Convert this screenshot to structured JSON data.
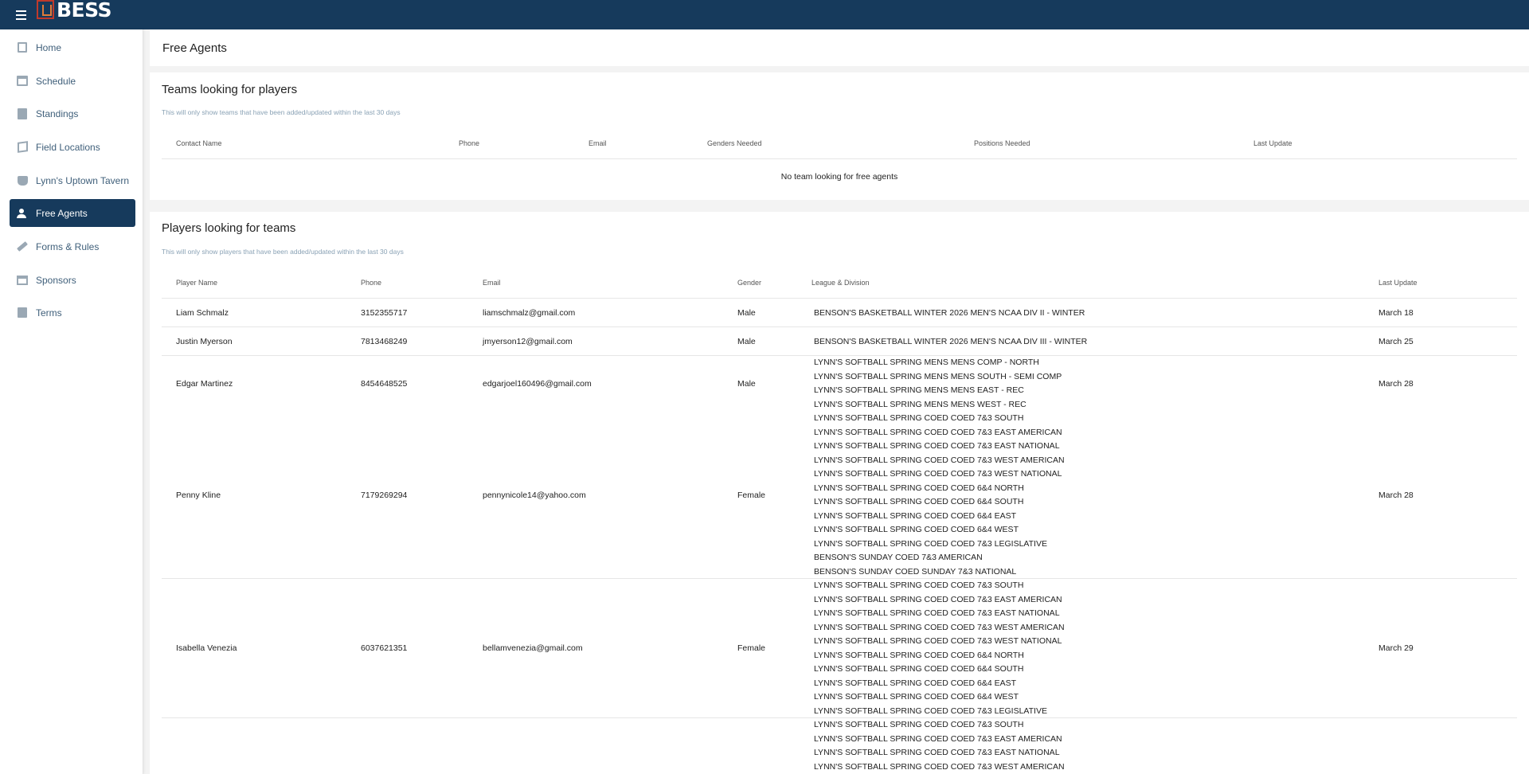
{
  "app": {
    "logo_text": "BESS"
  },
  "sidebar": {
    "items": [
      {
        "label": "Home",
        "icon": "copy-icon"
      },
      {
        "label": "Schedule",
        "icon": "calendar-icon"
      },
      {
        "label": "Standings",
        "icon": "clipboard-icon"
      },
      {
        "label": "Field Locations",
        "icon": "map-icon"
      },
      {
        "label": "Lynn's Uptown Tavern",
        "icon": "cup-icon"
      },
      {
        "label": "Free Agents",
        "icon": "person-add-icon",
        "active": true
      },
      {
        "label": "Forms & Rules",
        "icon": "gavel-icon"
      },
      {
        "label": "Sponsors",
        "icon": "store-icon"
      },
      {
        "label": "Terms",
        "icon": "document-icon"
      }
    ]
  },
  "page": {
    "title": "Free Agents"
  },
  "teams": {
    "title": "Teams looking for players",
    "subtitle": "This will only show teams that have been added/updated within the last 30 days",
    "columns": [
      "Contact Name",
      "Phone",
      "Email",
      "Genders Needed",
      "Positions Needed",
      "Last Update"
    ],
    "empty_message": "No team looking for free agents"
  },
  "players": {
    "title": "Players looking for teams",
    "subtitle": "This will only show players that have been added/updated within the last 30 days",
    "columns": [
      "Player Name",
      "Phone",
      "Email",
      "Gender",
      "League & Division",
      "Last Update"
    ],
    "rows": [
      {
        "name": "Liam Schmalz",
        "phone": "3152355717",
        "email": "liamschmalz@gmail.com",
        "gender": "Male",
        "divisions": [
          "BENSON'S BASKETBALL WINTER 2026 MEN'S NCAA DIV II - WINTER"
        ],
        "last_update": "March 18"
      },
      {
        "name": "Justin Myerson",
        "phone": "7813468249",
        "email": "jmyerson12@gmail.com",
        "gender": "Male",
        "divisions": [
          "BENSON'S BASKETBALL WINTER 2026 MEN'S NCAA DIV III - WINTER"
        ],
        "last_update": "March 25"
      },
      {
        "name": "Edgar Martinez",
        "phone": "8454648525",
        "email": "edgarjoel160496@gmail.com",
        "gender": "Male",
        "divisions": [
          "LYNN'S SOFTBALL SPRING MENS MENS COMP - NORTH",
          "LYNN'S SOFTBALL SPRING MENS MENS SOUTH - SEMI COMP",
          "LYNN'S SOFTBALL SPRING MENS MENS EAST - REC",
          "LYNN'S SOFTBALL SPRING MENS MENS WEST - REC"
        ],
        "last_update": "March 28"
      },
      {
        "name": "Penny Kline",
        "phone": "7179269294",
        "email": "pennynicole14@yahoo.com",
        "gender": "Female",
        "divisions": [
          "LYNN'S SOFTBALL SPRING COED COED 7&3 SOUTH",
          "LYNN'S SOFTBALL SPRING COED COED 7&3 EAST AMERICAN",
          "LYNN'S SOFTBALL SPRING COED COED 7&3 EAST NATIONAL",
          "LYNN'S SOFTBALL SPRING COED COED 7&3 WEST AMERICAN",
          "LYNN'S SOFTBALL SPRING COED COED 7&3 WEST NATIONAL",
          "LYNN'S SOFTBALL SPRING COED COED 6&4 NORTH",
          "LYNN'S SOFTBALL SPRING COED COED 6&4 SOUTH",
          "LYNN'S SOFTBALL SPRING COED COED 6&4 EAST",
          "LYNN'S SOFTBALL SPRING COED COED 6&4 WEST",
          "LYNN'S SOFTBALL SPRING COED COED 7&3 LEGISLATIVE",
          "BENSON'S SUNDAY COED 7&3 AMERICAN",
          "BENSON'S SUNDAY COED SUNDAY 7&3 NATIONAL"
        ],
        "last_update": "March 28"
      },
      {
        "name": "Isabella Venezia",
        "phone": "6037621351",
        "email": "bellamvenezia@gmail.com",
        "gender": "Female",
        "divisions": [
          "LYNN'S SOFTBALL SPRING COED COED 7&3 SOUTH",
          "LYNN'S SOFTBALL SPRING COED COED 7&3 EAST AMERICAN",
          "LYNN'S SOFTBALL SPRING COED COED 7&3 EAST NATIONAL",
          "LYNN'S SOFTBALL SPRING COED COED 7&3 WEST AMERICAN",
          "LYNN'S SOFTBALL SPRING COED COED 7&3 WEST NATIONAL",
          "LYNN'S SOFTBALL SPRING COED COED 6&4 NORTH",
          "LYNN'S SOFTBALL SPRING COED COED 6&4 SOUTH",
          "LYNN'S SOFTBALL SPRING COED COED 6&4 EAST",
          "LYNN'S SOFTBALL SPRING COED COED 6&4 WEST",
          "LYNN'S SOFTBALL SPRING COED COED 7&3 LEGISLATIVE"
        ],
        "last_update": "March 29"
      },
      {
        "name": "",
        "phone": "",
        "email": "",
        "gender": "",
        "divisions": [
          "LYNN'S SOFTBALL SPRING COED COED 7&3 SOUTH",
          "LYNN'S SOFTBALL SPRING COED COED 7&3 EAST AMERICAN",
          "LYNN'S SOFTBALL SPRING COED COED 7&3 EAST NATIONAL",
          "LYNN'S SOFTBALL SPRING COED COED 7&3 WEST AMERICAN"
        ],
        "last_update": ""
      }
    ]
  }
}
